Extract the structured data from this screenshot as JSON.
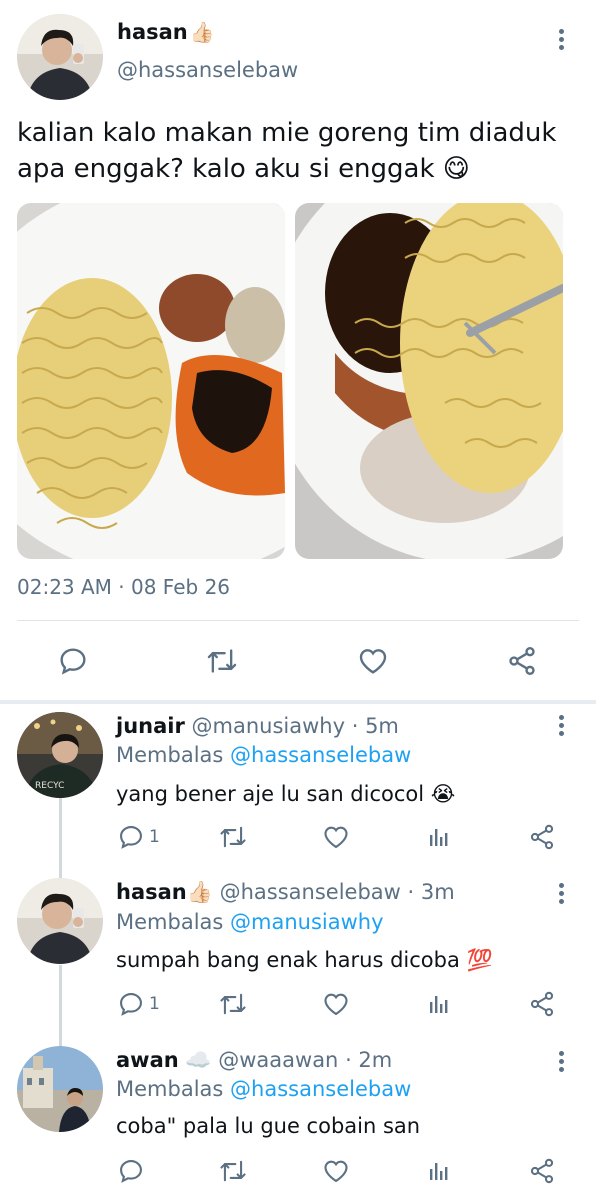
{
  "tweet": {
    "author_name": "hasan",
    "author_emoji": "👍🏻",
    "author_handle": "@hassanselebaw",
    "text": "kalian kalo makan mie goreng tim diaduk apa enggak? kalo aku si enggak 😋",
    "timestamp": "02:23 AM · 08 Feb 26",
    "actions": [
      "reply-icon",
      "retweet-icon",
      "like-icon",
      "share-icon"
    ]
  },
  "replies": [
    {
      "name": "junair",
      "emoji": "",
      "handle": "@manusiawhy",
      "time": "· 5m",
      "replying_label": "Membalas",
      "replying_to": "@hassanselebaw",
      "text": "yang bener aje lu san dicocol 😭",
      "reply_count": "1"
    },
    {
      "name": "hasan",
      "emoji": "👍🏻",
      "handle": "@hassanselebaw",
      "time": "· 3m",
      "replying_label": "Membalas",
      "replying_to": "@manusiawhy",
      "text": "sumpah bang enak harus dicoba 💯",
      "reply_count": "1"
    },
    {
      "name": "awan",
      "emoji": "☁️",
      "handle": "@waaawan",
      "time": "· 2m",
      "replying_label": "Membalas",
      "replying_to": "@hassanselebaw",
      "text": "coba\" pala lu gue cobain san",
      "reply_count": ""
    }
  ],
  "colors": {
    "text": "#0f1419",
    "secondary": "#5b7083",
    "link": "#1da1f2",
    "divider": "#e7ecf0"
  }
}
